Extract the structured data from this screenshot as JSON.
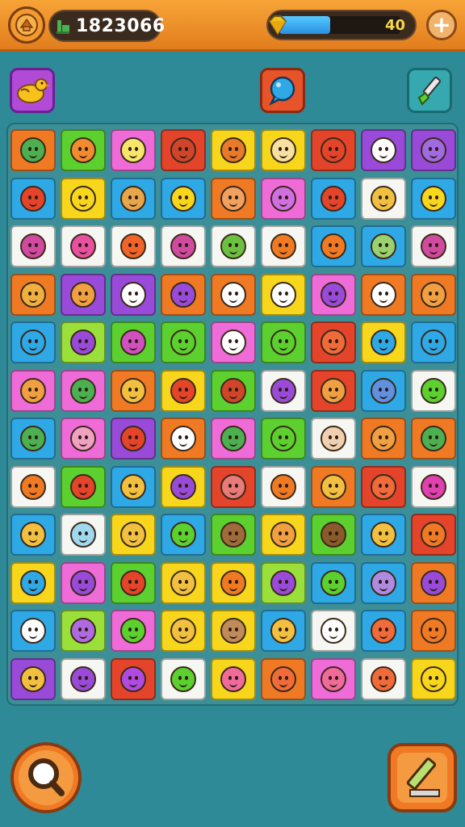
{
  "header": {
    "score": "1823066",
    "energy_value": "40",
    "energy_fraction": 0.42,
    "add_label": "+"
  },
  "colors": {
    "orange": "#f07a24",
    "green": "#5cd02e",
    "pink": "#ef6cd8",
    "red": "#e4442a",
    "yellow": "#f7d61c",
    "blue": "#2fa8e6",
    "white": "#f6f6f2",
    "purple": "#9a4ad8",
    "lime": "#9be03a"
  },
  "powerups": [
    {
      "name": "chicken-powerup-button",
      "icon": "chicken-icon"
    },
    {
      "name": "bubble-powerup-button",
      "icon": "bubble-icon"
    },
    {
      "name": "brush-powerup-button",
      "icon": "brush-icon"
    }
  ],
  "board": {
    "rows": [
      [
        "orange",
        "green",
        "pink",
        "red",
        "yellow",
        "yellow",
        "red",
        "purple",
        "purple"
      ],
      [
        "blue",
        "yellow",
        "blue",
        "blue",
        "orange",
        "pink",
        "blue",
        "white",
        "blue"
      ],
      [
        "white",
        "white",
        "white",
        "white",
        "white",
        "white",
        "blue",
        "blue",
        "white"
      ],
      [
        "orange",
        "purple",
        "purple",
        "orange",
        "orange",
        "yellow",
        "pink",
        "orange",
        "orange"
      ],
      [
        "blue",
        "lime",
        "green",
        "green",
        "pink",
        "green",
        "red",
        "yellow",
        "blue"
      ],
      [
        "pink",
        "pink",
        "orange",
        "yellow",
        "green",
        "white",
        "red",
        "blue",
        "white"
      ],
      [
        "blue",
        "pink",
        "purple",
        "orange",
        "pink",
        "green",
        "white",
        "orange",
        "orange"
      ],
      [
        "white",
        "green",
        "blue",
        "yellow",
        "red",
        "white",
        "orange",
        "red",
        "white"
      ],
      [
        "blue",
        "white",
        "yellow",
        "blue",
        "green",
        "yellow",
        "green",
        "blue",
        "red"
      ],
      [
        "yellow",
        "pink",
        "green",
        "yellow",
        "yellow",
        "lime",
        "blue",
        "blue",
        "orange"
      ],
      [
        "blue",
        "lime",
        "pink",
        "yellow",
        "yellow",
        "blue",
        "white",
        "blue",
        "orange"
      ],
      [
        "purple",
        "white",
        "red",
        "white",
        "yellow",
        "orange",
        "pink",
        "white",
        "yellow"
      ]
    ],
    "faces": [
      [
        "#4caf50",
        "#f28a2e",
        "#f7e66a",
        "#d0452a",
        "#e87a2a",
        "#f7e0a0",
        "#e4442a",
        "#fff",
        "#a06ae0"
      ],
      [
        "#e4442a",
        "#f7d61c",
        "#e8a64a",
        "#f7d61c",
        "#f2a060",
        "#d070e0",
        "#e4442a",
        "#f2c040",
        "#f7d61c"
      ],
      [
        "#d04aa0",
        "#e850a0",
        "#f0642a",
        "#d04aa0",
        "#6cc040",
        "#f07a24",
        "#f07a24",
        "#9ad070",
        "#d04aa0"
      ],
      [
        "#f0b040",
        "#f0a040",
        "#fff",
        "#9a4ad8",
        "#fff",
        "#fff",
        "#9a4ad8",
        "#fff",
        "#f0a040"
      ],
      [
        "#2fa8e6",
        "#9a4ad8",
        "#d050c0",
        "#5cd02e",
        "#fff",
        "#5cd02e",
        "#f06a3a",
        "#2fa8e6",
        "#2fa8e6"
      ],
      [
        "#f0a040",
        "#4caf50",
        "#f2c040",
        "#e4442a",
        "#d0452a",
        "#9a4ad8",
        "#f0a040",
        "#6090e0",
        "#5cd02e"
      ],
      [
        "#4caf50",
        "#f0a0c0",
        "#e4442a",
        "#fff",
        "#4caf50",
        "#5cd02e",
        "#f0d0b0",
        "#f0a040",
        "#4caf50"
      ],
      [
        "#f07a24",
        "#e4442a",
        "#f2c040",
        "#9a4ad8",
        "#e87a7a",
        "#f07a24",
        "#f2c040",
        "#f06a3a",
        "#e040b0"
      ],
      [
        "#f2c040",
        "#a0d8f0",
        "#f2c040",
        "#5cd02e",
        "#a06a3a",
        "#f0a040",
        "#8a5a2a",
        "#f2c040",
        "#f07a24"
      ],
      [
        "#2fa8e6",
        "#9a4ad8",
        "#e4442a",
        "#f2c040",
        "#f07a24",
        "#9a4ad8",
        "#5cd02e",
        "#b08ae0",
        "#9a4ad8"
      ],
      [
        "#fff",
        "#b06ae0",
        "#5cd02e",
        "#f2c040",
        "#c08a5a",
        "#f2c040",
        "#fff",
        "#f06a3a",
        "#f07a24"
      ],
      [
        "#f2c040",
        "#9a4ad8",
        "#b04ae0",
        "#5cd02e",
        "#f06a9a",
        "#f06a3a",
        "#f06a9a",
        "#f06a3a",
        "#f7d61c"
      ]
    ]
  },
  "controls": {
    "left": {
      "name": "magnifier-button",
      "icon": "magnifier-icon"
    },
    "right": {
      "name": "hint-pen-button",
      "icon": "pen-icon"
    }
  }
}
